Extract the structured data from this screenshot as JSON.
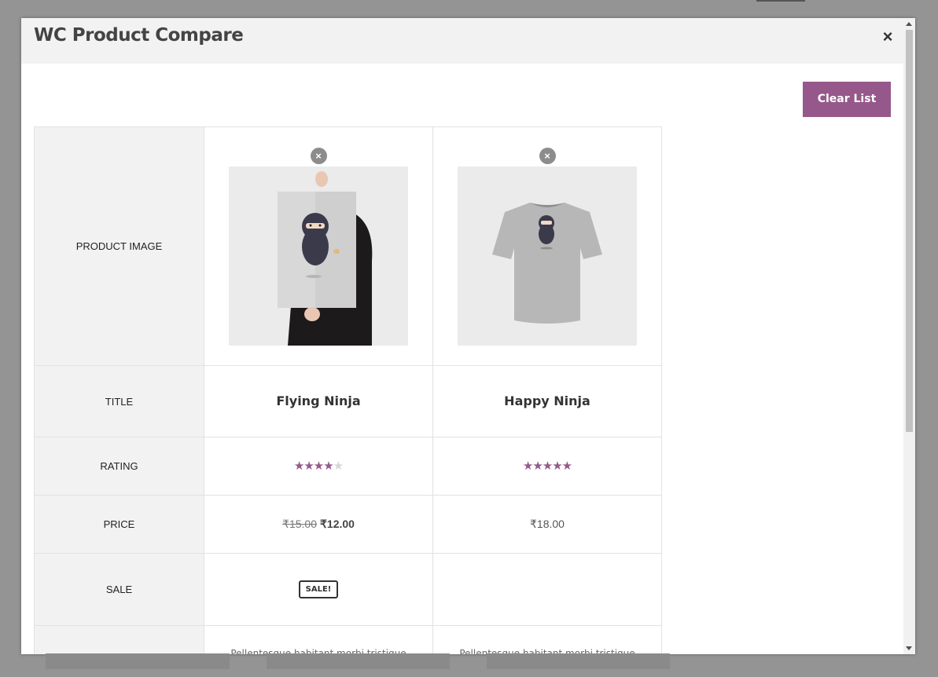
{
  "modal": {
    "title": "WC Product Compare",
    "close_label": "×",
    "clear_button_label": "Clear List"
  },
  "rows": {
    "image": "PRODUCT IMAGE",
    "title": "TITLE",
    "rating": "RATING",
    "price": "PRICE",
    "sale": "SALE"
  },
  "products": [
    {
      "title": "Flying Ninja",
      "rating": 4,
      "stars": "★★★★",
      "star_off": "★",
      "price_old": "₹15.00",
      "price_new": "₹12.00",
      "sale_badge": "SALE!",
      "description": "Pellentesque habitant morbi tristique",
      "remove_label": "×",
      "image_icon": "poster-ninja-image"
    },
    {
      "title": "Happy Ninja",
      "rating": 5,
      "stars": "★★★★★",
      "star_off": "",
      "price": "₹18.00",
      "sale_badge": "",
      "description": "Pellentesque habitant morbi tristique",
      "remove_label": "×",
      "image_icon": "tshirt-ninja-image"
    }
  ],
  "colors": {
    "accent": "#96588a",
    "header_bg": "#f2f2f2",
    "overlay": "#949494"
  }
}
